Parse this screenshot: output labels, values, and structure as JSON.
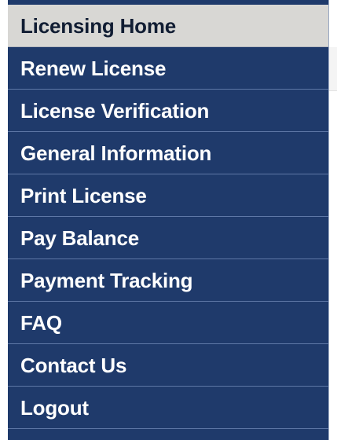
{
  "menu": {
    "active_index": 0,
    "items": [
      {
        "label": "Licensing Home"
      },
      {
        "label": "Renew License"
      },
      {
        "label": "License Verification"
      },
      {
        "label": "General Information"
      },
      {
        "label": "Print License"
      },
      {
        "label": "Pay Balance"
      },
      {
        "label": "Payment Tracking"
      },
      {
        "label": "FAQ"
      },
      {
        "label": "Contact Us"
      },
      {
        "label": "Logout"
      }
    ]
  },
  "colors": {
    "menu_background": "#1f3a6b",
    "active_background": "#d8d7d4",
    "divider": "#5e77a6",
    "text": "#ffffff",
    "active_text": "#111d33"
  }
}
